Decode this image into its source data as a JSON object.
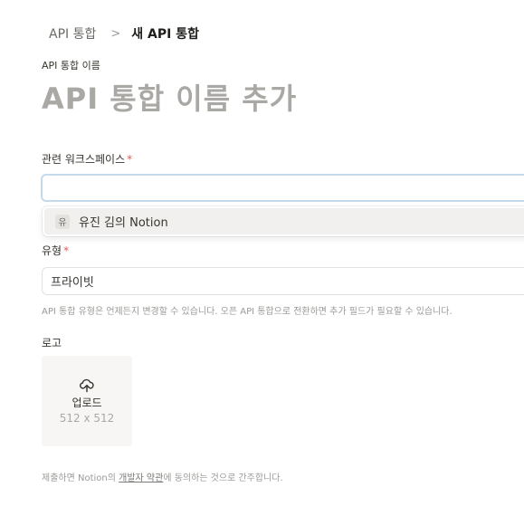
{
  "breadcrumb": {
    "parent": "API 통합",
    "separator": ">",
    "current": "새 API 통합"
  },
  "integration_name": {
    "label": "API 통합 이름",
    "placeholder": "API 통합 이름 추가"
  },
  "workspace": {
    "label": "관련 워크스페이스",
    "required_mark": "*",
    "value": "",
    "options": [
      {
        "avatar": "유",
        "name": "유진 김의 Notion"
      }
    ]
  },
  "type": {
    "label": "유형",
    "required_mark": "*",
    "value": "프라이빗",
    "hint": "API 통합 유형은 언제든지 변경할 수 있습니다. 오픈 API 통합으로 전환하면 추가 필드가 필요할 수 있습니다."
  },
  "logo": {
    "label": "로고",
    "upload_icon": "cloud-upload-icon",
    "upload_label": "업로드",
    "size_text": "512 x 512"
  },
  "footer": {
    "prefix": "제출하면 Notion의 ",
    "link": "개발자 약관",
    "suffix": "에 동의하는 것으로 간주합니다."
  },
  "colors": {
    "required": "#eb5757",
    "focus_border": "#c4d9ea",
    "placeholder": "#a9a8a4"
  }
}
